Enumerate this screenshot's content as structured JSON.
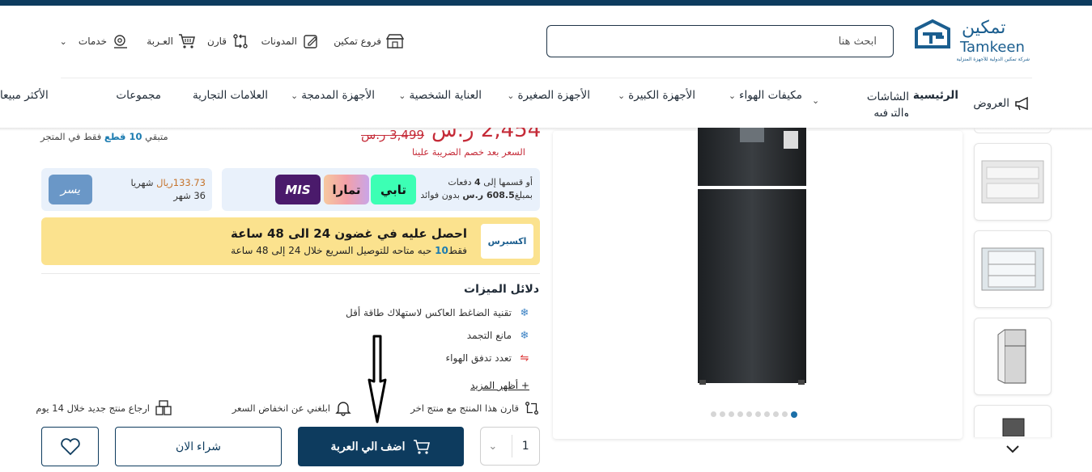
{
  "brand": {
    "name_ar": "تمكين",
    "name_en": "Tamkeen",
    "tagline": "شركة تمكين الدولية للأجهزة المنزلية"
  },
  "search": {
    "placeholder": "ابحث هنا"
  },
  "utility_links": {
    "branches": "فروع تمكين",
    "blogs": "المدونات",
    "compare": "قارن",
    "cart": "العـربة",
    "services": "خدمات"
  },
  "nav": {
    "offers": "العروض",
    "home": "الرئيسية",
    "screens": "الشاشات والترفيه",
    "ac": "مكيفات الهواء",
    "large": "الأجهزة الكبيرة",
    "small": "الأجهزة الصغيرة",
    "personal": "العناية الشخصية",
    "built_in": "الأجهزة المدمجة",
    "brands": "العلامات التجارية",
    "collections": "مجموعات",
    "best_sellers": "الأكثر مبيعا"
  },
  "gallery": {
    "active_dot": 0,
    "dot_count": 10
  },
  "price": {
    "current": "2,454 ر.س",
    "old": "3,499 ر.س",
    "tax_note": "السعر بعد خصم الضريبة علينا",
    "stock_prefix": "متبقي",
    "stock_count": "10 قطع",
    "stock_suffix": "فقط في المتجر"
  },
  "installments": {
    "line1_prefix": "أو قسمها إلى",
    "line1_count": "4",
    "line1_suffix": "دفعات",
    "line2_prefix": "بمبلغ",
    "line2_amount": "608.5 ر.س",
    "line2_suffix": "بدون فوائد",
    "providers": [
      "تابي",
      "تمارا",
      "MIS"
    ]
  },
  "monthly": {
    "amount": "133.73ريال",
    "period_label": "شهريا",
    "months": "36 شهر",
    "logo": "يسر"
  },
  "express": {
    "logo": "اكسبرس",
    "title": "احصل عليه في غضون 24 الى 48 ساعة",
    "sub_prefix": "فقط",
    "sub_count": "10",
    "sub_suffix": "حبه متاحه للتوصيل السريع خلال 24 إلى 48 ساعة"
  },
  "features": {
    "title": "دلائل الميزات",
    "items": [
      "تقنية الضاغط العاكس لاستهلاك طاقة أقل",
      "مانع التجمد",
      "تعدد تدفق الهواء"
    ],
    "show_more": "+ أظهر المزيد"
  },
  "actions": {
    "compare": "قارن هذا المنتج مع منتج اخر",
    "price_alert": "ابلغني عن انخفاض السعر",
    "return": "ارجاع منتج جديد خلال 14 يوم"
  },
  "purchase": {
    "quantity": "1",
    "add_to_cart": "اضف الي العربة",
    "buy_now": "شراء الان"
  },
  "colors": {
    "primary": "#0d3b5e",
    "price_red": "#c52b38",
    "express_bg": "#fbe28e",
    "info_bg": "#e9f1fb"
  }
}
